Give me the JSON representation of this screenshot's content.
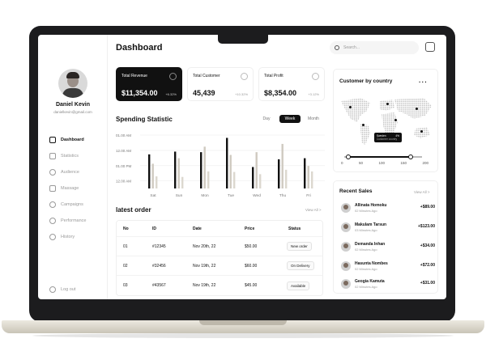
{
  "app": {
    "title": "Dashboard"
  },
  "user": {
    "name": "Daniel Kevin",
    "email": "danielkevin@gmail.com"
  },
  "nav": [
    {
      "label": "Dashboard",
      "active": true
    },
    {
      "label": "Statistics"
    },
    {
      "label": "Audience"
    },
    {
      "label": "Massage"
    },
    {
      "label": "Campaigns"
    },
    {
      "label": "Performance"
    },
    {
      "label": "History"
    }
  ],
  "logout_label": "Log out",
  "search": {
    "placeholder": "Search..."
  },
  "cards": [
    {
      "label": "Total Revenue",
      "value": "$11,354.00",
      "change": "+6.32%"
    },
    {
      "label": "Total Customer",
      "value": "45,439",
      "change": "+10.32%"
    },
    {
      "label": "Total Profit",
      "value": "$8,354.00",
      "change": "+3.12%"
    }
  ],
  "spending": {
    "title": "Spending Statistic",
    "tabs": [
      "Day",
      "Week",
      "Month"
    ],
    "active_tab": "Week"
  },
  "chart_data": {
    "type": "bar",
    "categories": [
      "Sat",
      "Sun",
      "Mon",
      "Tue",
      "Wed",
      "Thu",
      "Fri"
    ],
    "yticks": [
      "01.00 AM",
      "12.00 AM",
      "01.00 PM",
      "12.00 AM"
    ],
    "series": [
      {
        "values": [
          0.62,
          0.67,
          0.66,
          0.92,
          0.39,
          0.53,
          0.55
        ]
      },
      {
        "values": [
          0.45,
          0.55,
          0.76,
          0.61,
          0.66,
          0.81,
          0.41
        ]
      },
      {
        "values": [
          0.22,
          0.21,
          0.31,
          0.3,
          0.26,
          0.34,
          0.31
        ]
      }
    ],
    "colors": [
      "#111111",
      "#cfcac0",
      "#dcd8cf"
    ]
  },
  "orders": {
    "title": "latest order",
    "view_all": "View All >",
    "columns": [
      "No",
      "ID",
      "Date",
      "Price",
      "Status"
    ],
    "rows": [
      {
        "no": "01",
        "id": "#12345",
        "date": "Nov 20th, 22",
        "price": "$50.00",
        "status": "New order"
      },
      {
        "no": "02",
        "id": "#32456",
        "date": "Nov 19th, 22",
        "price": "$60.00",
        "status": "On Delivery"
      },
      {
        "no": "03",
        "id": "#43567",
        "date": "Nov 19th, 22",
        "price": "$45.00",
        "status": "Available"
      }
    ]
  },
  "country": {
    "title": "Customer by country",
    "tooltip_country": "Sweden",
    "tooltip_pct": "4%",
    "tooltip_sub": "Customer country",
    "scale": [
      "0",
      "50",
      "100",
      "150",
      "200"
    ],
    "range": [
      0.05,
      0.85
    ]
  },
  "sales": {
    "title": "Recent Sales",
    "view_all": "View All >",
    "items": [
      {
        "name": "Allinata Homoku",
        "time": "02 Minutes Ago",
        "amount": "+$89.00"
      },
      {
        "name": "Makulam Tarsun",
        "time": "03 Minutes Ago",
        "amount": "+$123.00"
      },
      {
        "name": "Demanda Inhan",
        "time": "02 Minutes Ago",
        "amount": "+$34.00"
      },
      {
        "name": "Hasunta Nombes",
        "time": "02 Minutes Ago",
        "amount": "+$72.00"
      },
      {
        "name": "Geogia Kamuta",
        "time": "02 Minutes Ago",
        "amount": "+$31.00"
      }
    ]
  }
}
